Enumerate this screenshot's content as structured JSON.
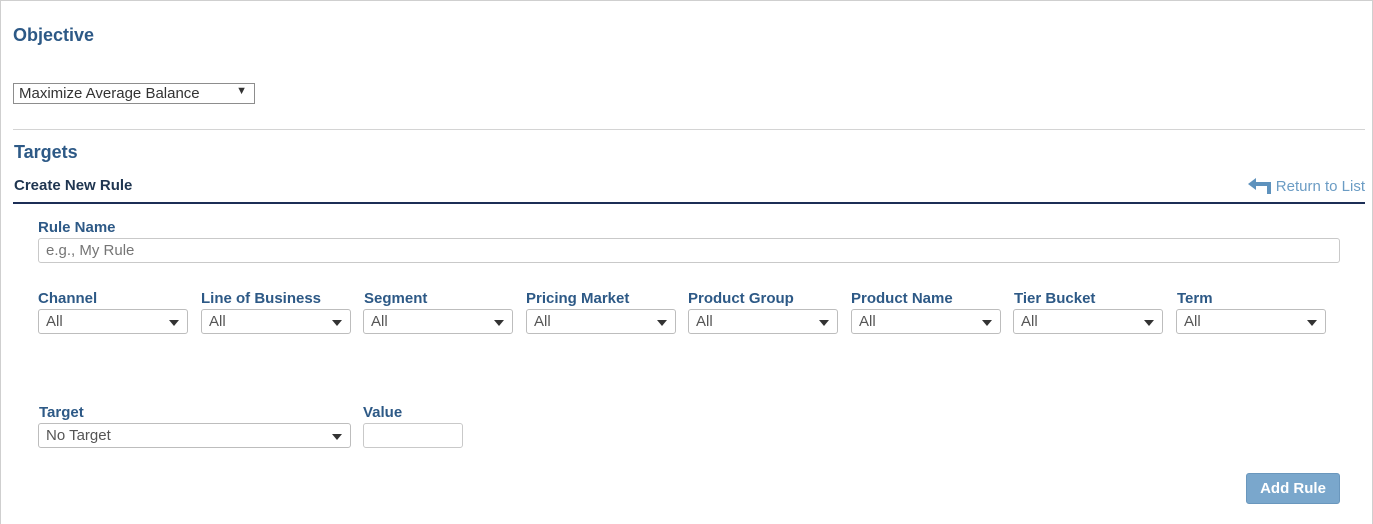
{
  "objective": {
    "title": "Objective",
    "selected": "Maximize Average Balance",
    "dropdown_icon": "triangle-down"
  },
  "targets": {
    "title": "Targets",
    "create_new_rule": "Create New Rule",
    "return_to_list": "Return to List",
    "return_icon": "return-arrow"
  },
  "form": {
    "rule_name_label": "Rule Name",
    "rule_name_placeholder": "e.g., My Rule",
    "filters": [
      {
        "label": "Channel",
        "value": "All"
      },
      {
        "label": "Line of Business",
        "value": "All"
      },
      {
        "label": "Segment",
        "value": "All"
      },
      {
        "label": "Pricing Market",
        "value": "All"
      },
      {
        "label": "Product Group",
        "value": "All"
      },
      {
        "label": "Product Name",
        "value": "All"
      },
      {
        "label": "Tier Bucket",
        "value": "All"
      },
      {
        "label": "Term",
        "value": "All"
      }
    ],
    "target_label": "Target",
    "target_value": "No Target",
    "value_label": "Value",
    "value_value": "",
    "add_rule_label": "Add Rule"
  },
  "colors": {
    "heading": "#2d5986",
    "rule_line": "#1c2e56",
    "button": "#7aa7cc",
    "link": "#6b9cc4"
  }
}
